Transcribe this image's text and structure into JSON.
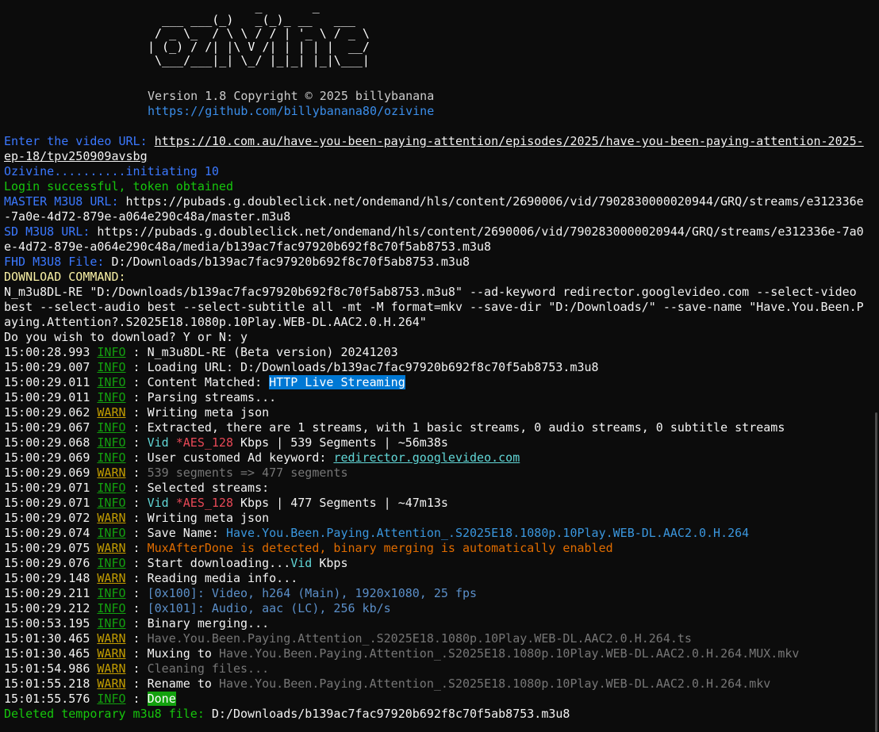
{
  "header": {
    "logo_art": "               _       _\n  ___ ___(_)   _(_)_ __   ___\n / _ \\_  / \\ \\ / / | '_ \\ / _ \\\n| (_) / /| |\\ V /| | | | |  __/\n \\___/___|_| \\_/ |_|_| |_|\\___|",
    "version": "Version 1.8 Copyright © 2025 billybanana",
    "github_url": "https://github.com/billybanana80/ozivine"
  },
  "prompt": {
    "url_label": "Enter the video URL: ",
    "url_value_1": "https://10.com.au/have-you-been-paying-attention/episodes/2025/have-you-been-paying-attention-2025-",
    "url_value_2": "ep-18/tpv250909avsbg",
    "initiating": "Ozivine..........initiating 10",
    "login": "Login successful, token obtained",
    "master_label": "MASTER M3U8 URL: ",
    "master_value_1": "https://pubads.g.doubleclick.net/ondemand/hls/content/2690006/vid/7902830000020944/GRQ/streams/e312336e",
    "master_value_2": "-7a0e-4d72-879e-a064e290c48a/master.m3u8",
    "sd_label": "SD M3U8 URL: ",
    "sd_value_1": "https://pubads.g.doubleclick.net/ondemand/hls/content/2690006/vid/7902830000020944/GRQ/streams/e312336e-7a0",
    "sd_value_2": "e-4d72-879e-a064e290c48a/media/b139ac7fac97920b692f8c70f5ab8753.m3u8",
    "fhd_label": "FHD M3U8 File: ",
    "fhd_value": "D:/Downloads/b139ac7fac97920b692f8c70f5ab8753.m3u8",
    "download_cmd_label": "DOWNLOAD COMMAND:",
    "cmd_1": "N_m3u8DL-RE \"D:/Downloads/b139ac7fac97920b692f8c70f5ab8753.m3u8\" --ad-keyword redirector.googlevideo.com --select-video",
    "cmd_2": "best --select-audio best --select-subtitle all -mt -M format=mkv --save-dir \"D:/Downloads/\" --save-name \"Have.You.Been.P",
    "cmd_3": "aying.Attention?.S2025E18.1080p.10Play.WEB-DL.AAC2.0.H.264\"",
    "ask": "Do you wish to download? Y or N: y"
  },
  "log": [
    {
      "time": "15:00:28.993",
      "level": "INFO",
      "segs": [
        {
          "t": "N_m3u8DL-RE (Beta version) 20241203",
          "c": ""
        }
      ]
    },
    {
      "time": "15:00:29.007",
      "level": "INFO",
      "segs": [
        {
          "t": "Loading URL: D:/Downloads/b139ac7fac97920b692f8c70f5ab8753.m3u8",
          "c": ""
        }
      ]
    },
    {
      "time": "15:00:29.011",
      "level": "INFO",
      "segs": [
        {
          "t": "Content Matched: ",
          "c": ""
        },
        {
          "t": "HTTP Live Streaming",
          "c": "hl"
        }
      ]
    },
    {
      "time": "15:00:29.011",
      "level": "INFO",
      "segs": [
        {
          "t": "Parsing streams...",
          "c": ""
        }
      ]
    },
    {
      "time": "15:00:29.062",
      "level": "WARN",
      "segs": [
        {
          "t": "Writing meta json",
          "c": ""
        }
      ]
    },
    {
      "time": "15:00:29.067",
      "level": "INFO",
      "segs": [
        {
          "t": "Extracted, there are 1 streams, with 1 basic streams, 0 audio streams, 0 subtitle streams",
          "c": ""
        }
      ]
    },
    {
      "time": "15:00:29.068",
      "level": "INFO",
      "segs": [
        {
          "t": "Vid ",
          "c": "cyan"
        },
        {
          "t": "*AES_128",
          "c": "red"
        },
        {
          "t": " Kbps | 539 Segments | ~56m38s",
          "c": ""
        }
      ]
    },
    {
      "time": "15:00:29.069",
      "level": "INFO",
      "segs": [
        {
          "t": "User customed Ad keyword: ",
          "c": ""
        },
        {
          "t": "redirector.googlevideo.com",
          "c": "hlink"
        }
      ]
    },
    {
      "time": "15:00:29.069",
      "level": "WARN",
      "segs": [
        {
          "t": "539 segments => 477 segments",
          "c": "gray"
        }
      ]
    },
    {
      "time": "15:00:29.071",
      "level": "INFO",
      "segs": [
        {
          "t": "Selected streams:",
          "c": ""
        }
      ]
    },
    {
      "time": "15:00:29.071",
      "level": "INFO",
      "segs": [
        {
          "t": "Vid ",
          "c": "cyan"
        },
        {
          "t": "*AES_128",
          "c": "red"
        },
        {
          "t": " Kbps | 477 Segments | ~47m13s",
          "c": ""
        }
      ]
    },
    {
      "time": "15:00:29.072",
      "level": "WARN",
      "segs": [
        {
          "t": "Writing meta json",
          "c": ""
        }
      ]
    },
    {
      "time": "15:00:29.074",
      "level": "INFO",
      "segs": [
        {
          "t": "Save Name: ",
          "c": ""
        },
        {
          "t": "Have.You.Been.Paying.Attention_.S2025E18.1080p.10Play.WEB-DL.AAC2.0.H.264",
          "c": "save"
        }
      ]
    },
    {
      "time": "15:00:29.075",
      "level": "WARN",
      "segs": [
        {
          "t": "MuxAfterDone is detected, binary merging is automatically enabled",
          "c": "orange"
        }
      ]
    },
    {
      "time": "15:00:29.076",
      "level": "INFO",
      "segs": [
        {
          "t": "Start downloading...",
          "c": ""
        },
        {
          "t": "Vid",
          "c": "cyan"
        },
        {
          "t": " Kbps",
          "c": ""
        }
      ]
    },
    {
      "time": "15:00:29.148",
      "level": "WARN",
      "segs": [
        {
          "t": "Reading media info...",
          "c": ""
        }
      ]
    },
    {
      "time": "15:00:29.211",
      "level": "INFO",
      "segs": [
        {
          "t": "[0x100]: Video, h264 (Main), 1920x1080, 25 fps",
          "c": "track"
        }
      ]
    },
    {
      "time": "15:00:29.212",
      "level": "INFO",
      "segs": [
        {
          "t": "[0x101]: Audio, aac (LC), 256 kb/s",
          "c": "track"
        }
      ]
    },
    {
      "time": "15:00:53.195",
      "level": "INFO",
      "segs": [
        {
          "t": "Binary merging...",
          "c": ""
        }
      ]
    },
    {
      "time": "15:01:30.465",
      "level": "WARN",
      "segs": [
        {
          "t": "Have.You.Been.Paying.Attention_.S2025E18.1080p.10Play.WEB-DL.AAC2.0.H.264.ts",
          "c": "gray"
        }
      ]
    },
    {
      "time": "15:01:30.465",
      "level": "WARN",
      "segs": [
        {
          "t": "Muxing to ",
          "c": ""
        },
        {
          "t": "Have.You.Been.Paying.Attention_.S2025E18.1080p.10Play.WEB-DL.AAC2.0.H.264.MUX.mkv",
          "c": "gray"
        }
      ]
    },
    {
      "time": "15:01:54.986",
      "level": "WARN",
      "segs": [
        {
          "t": "Cleaning files...",
          "c": "gray"
        }
      ]
    },
    {
      "time": "15:01:55.218",
      "level": "WARN",
      "segs": [
        {
          "t": "Rename to ",
          "c": ""
        },
        {
          "t": "Have.You.Been.Paying.Attention_.S2025E18.1080p.10Play.WEB-DL.AAC2.0.H.264.mkv",
          "c": "gray"
        }
      ]
    },
    {
      "time": "15:01:55.576",
      "level": "INFO",
      "segs": [
        {
          "t": "Done",
          "c": "done"
        }
      ]
    }
  ],
  "footer": {
    "deleted_label": "Deleted temporary m3u8 file: ",
    "deleted_value": "D:/Downloads/b139ac7fac97920b692f8c70f5ab8753.m3u8"
  },
  "colors": {
    "background": "#0c0c0c",
    "foreground": "#cccccc",
    "info": "#13a10e",
    "warn": "#c19c00",
    "label_blue": "#3b78ff"
  }
}
